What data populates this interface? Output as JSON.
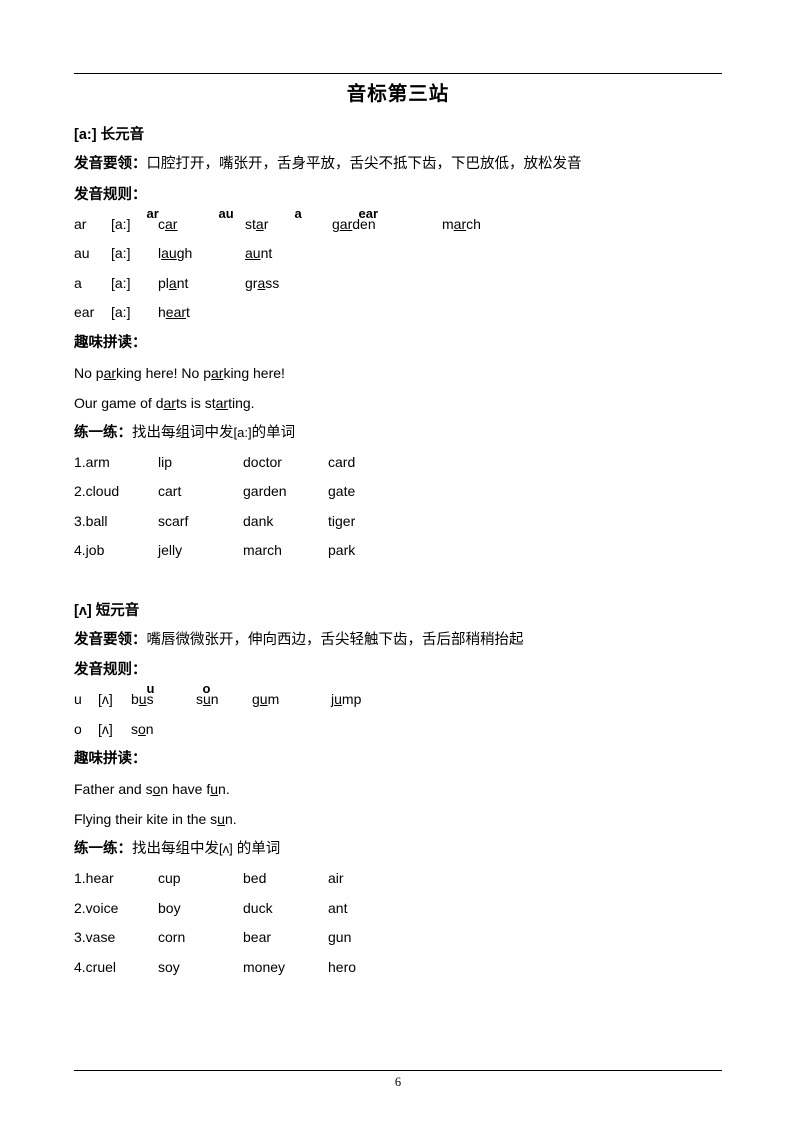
{
  "page": {
    "number": "6",
    "title": "音标第三站"
  },
  "sections": [
    {
      "heading": {
        "symbol": "[a:]",
        "label": "长元音"
      },
      "tips": {
        "label": "发音要领：",
        "text": "口腔打开，嘴张开，舌身平放，舌尖不抵下齿，下巴放低，放松发音"
      },
      "rules": {
        "label": "发音规则：",
        "items": [
          "ar",
          "au",
          "a",
          "ear"
        ]
      },
      "rule_rows": [
        {
          "letters": "ar",
          "phoneme": "[a:]",
          "words": [
            {
              "pre": "c",
              "mid": "ar",
              "post": ""
            },
            {
              "pre": "st",
              "mid": "a",
              "post": "r"
            },
            {
              "pre": "g",
              "mid": "ar",
              "post": "den"
            },
            {
              "pre": "m",
              "mid": "ar",
              "post": "ch"
            }
          ]
        },
        {
          "letters": "au",
          "phoneme": "[a:]",
          "words": [
            {
              "pre": "l",
              "mid": "au",
              "post": "gh"
            },
            {
              "pre": "",
              "mid": "au",
              "post": "nt"
            }
          ]
        },
        {
          "letters": "a",
          "phoneme": "[a:]",
          "words": [
            {
              "pre": "pl",
              "mid": "a",
              "post": "nt"
            },
            {
              "pre": "gr",
              "mid": "a",
              "post": "ss"
            }
          ]
        },
        {
          "letters": "ear",
          "phoneme": "[a:]",
          "words": [
            {
              "pre": "h",
              "mid": "ear",
              "post": "t"
            }
          ]
        }
      ],
      "chant_label": "趣味拼读：",
      "chant_lines": [
        [
          {
            "t": "No p"
          },
          {
            "t": "ar",
            "u": true
          },
          {
            "t": "king here! No p"
          },
          {
            "t": "ar",
            "u": true
          },
          {
            "t": "king here!"
          }
        ],
        [
          {
            "t": "Our game of d"
          },
          {
            "t": "ar",
            "u": true
          },
          {
            "t": "ts is st"
          },
          {
            "t": "ar",
            "u": true
          },
          {
            "t": "ting."
          }
        ]
      ],
      "practice": {
        "label": "练一练：",
        "text_before": "找出每组词中发",
        "symbol": "[a:]",
        "text_after": "的单词"
      },
      "practice_rows": [
        [
          "1.arm",
          "lip",
          "doctor",
          "card"
        ],
        [
          "2.cloud",
          "cart",
          "garden",
          "gate"
        ],
        [
          "3.ball",
          "scarf",
          "dank",
          "tiger"
        ],
        [
          "4.job",
          "jelly",
          "march",
          "park"
        ]
      ]
    },
    {
      "heading": {
        "symbol": "[ʌ]",
        "label": "短元音"
      },
      "tips": {
        "label": "发音要领：",
        "text": "嘴唇微微张开，伸向西边，舌尖轻触下齿，舌后部稍稍抬起"
      },
      "rules": {
        "label": "发音规则：",
        "items": [
          "u",
          "o"
        ]
      },
      "rule_rows": [
        {
          "letters": "u",
          "phoneme": "[ʌ]",
          "words": [
            {
              "pre": "b",
              "mid": "u",
              "post": "s"
            },
            {
              "pre": "s",
              "mid": "u",
              "post": "n"
            },
            {
              "pre": "g",
              "mid": "u",
              "post": "m"
            },
            {
              "pre": "j",
              "mid": "u",
              "post": "mp"
            }
          ]
        },
        {
          "letters": "o",
          "phoneme": "[ʌ]",
          "words": [
            {
              "pre": "s",
              "mid": "o",
              "post": "n"
            }
          ]
        }
      ],
      "chant_label": "趣味拼读：",
      "chant_lines": [
        [
          {
            "t": "Father and s"
          },
          {
            "t": "o",
            "u": true
          },
          {
            "t": "n have f"
          },
          {
            "t": "u",
            "u": true
          },
          {
            "t": "n."
          }
        ],
        [
          {
            "t": "Flying their kite in the s"
          },
          {
            "t": "u",
            "u": true
          },
          {
            "t": "n."
          }
        ]
      ],
      "practice": {
        "label": "练一练：",
        "text_before": "找出每组中发",
        "symbol": "[ʌ]",
        "text_after": " 的单词"
      },
      "practice_rows": [
        [
          "1.hear",
          "cup",
          "bed",
          "air"
        ],
        [
          "2.voice",
          "boy",
          "duck",
          "ant"
        ],
        [
          "3.vase",
          "corn",
          "bear",
          "gun"
        ],
        [
          "4.cruel",
          "soy",
          "money",
          "hero"
        ]
      ]
    }
  ]
}
